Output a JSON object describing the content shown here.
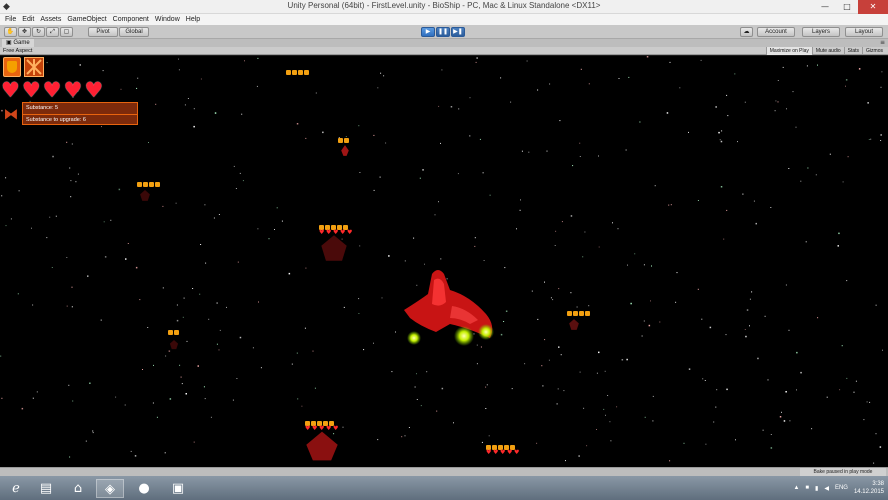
{
  "window": {
    "title": "Unity Personal (64bit) - FirstLevel.unity - BioShip - PC, Mac & Linux Standalone <DX11>",
    "minimize": "—",
    "maximize": "□",
    "close": "✕"
  },
  "menu": [
    "File",
    "Edit",
    "Assets",
    "GameObject",
    "Component",
    "Window",
    "Help"
  ],
  "toolbar": {
    "pivot": "Pivot",
    "global": "Global",
    "account": "Account",
    "layers": "Layers",
    "layout": "Layout",
    "play_icon": "▶",
    "pause_icon": "❚❚",
    "step_icon": "▶❚"
  },
  "game_tab": {
    "label": "Game",
    "aspect": "Free Aspect",
    "options": [
      "Maximize on Play",
      "Mute audio",
      "Stats",
      "Gizmos"
    ]
  },
  "hud": {
    "lives": 5,
    "substance_label": "Substance: 5",
    "upgrade_label": "Substance to upgrade: 6"
  },
  "status": {
    "message": "Bake paused in play mode"
  },
  "taskbar": {
    "language": "ENG",
    "time": "3:38",
    "date": "14.12.2015"
  },
  "colors": {
    "accent_orange": "#e8640f",
    "heart_red": "#ff2033",
    "play_blue": "#2f6fbf"
  }
}
